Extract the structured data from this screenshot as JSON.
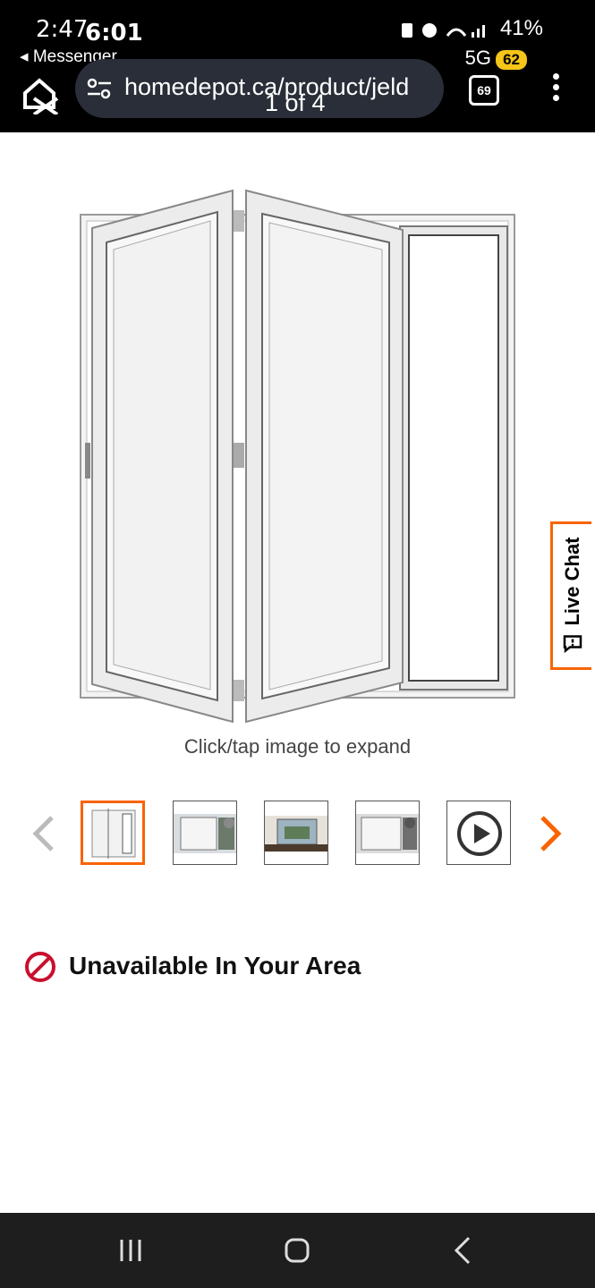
{
  "status_bar": {
    "time": "2:47",
    "overlay_time": "6:01",
    "back_app": "◂ Messenger",
    "battery": "41%",
    "network": "5G",
    "badge": "62"
  },
  "browser": {
    "url": "homedepot.ca/product/jeld",
    "page_indicator": "1 of 4",
    "tab_count": "69"
  },
  "product": {
    "expand_hint": "Click/tap image to expand",
    "availability": "Unavailable In Your Area"
  },
  "live_chat": {
    "label": "Live Chat"
  },
  "colors": {
    "accent": "#f96302",
    "unavailable": "#c8102e"
  },
  "icons": [
    "home-icon",
    "tune-icon",
    "tabs-icon",
    "menu-icon",
    "chevron-left-icon",
    "chevron-right-icon",
    "play-icon",
    "no-entry-icon",
    "chat-icon",
    "recents-icon",
    "home-nav-icon",
    "back-icon"
  ]
}
